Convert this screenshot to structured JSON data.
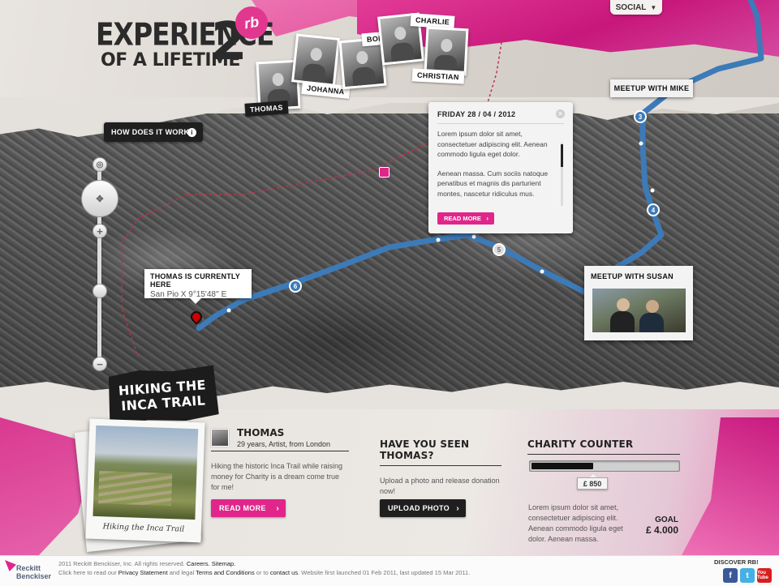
{
  "header": {
    "logo": {
      "line1": "EXPERIENCE",
      "line2": "OF A LIFETIME",
      "number": "2",
      "badge": "rb"
    },
    "social_label": "SOCIAL",
    "hikers": [
      {
        "name": "THOMAS"
      },
      {
        "name": "JOHANNA"
      },
      {
        "name": "BOB"
      },
      {
        "name": "CHARLIE"
      },
      {
        "name": "CHRISTIAN"
      }
    ]
  },
  "map": {
    "how_label": "HOW DOES IT WORK?",
    "current_location": {
      "title": "THOMAS IS CURRENTLY HERE",
      "coords": "San Pio X 9°15'48'' E"
    },
    "route_stops": [
      "3",
      "4",
      "5",
      "6"
    ],
    "blog_popup": {
      "date": "FRIDAY 28 / 04 / 2012",
      "para1": "Lorem ipsum dolor sit amet, consectetuer adipiscing elit. Aenean commodo ligula eget dolor.",
      "para2": "Aenean massa. Cum sociis natoque penatibus et magnis dis parturient montes, nascetur ridiculus mus.",
      "read_more": "READ MORE"
    },
    "meetup_mike": "MEETUP WITH MIKE",
    "meetup_susan": "MEETUP WITH SUSAN"
  },
  "plate": {
    "title": "HIKING THE INCA TRAIL"
  },
  "bottom": {
    "polaroid_caption": "Hiking the Inca Trail",
    "thomas": {
      "name": "THOMAS",
      "subtitle": "29 years, Artist, from London",
      "text": "Hiking the historic Inca Trail while raising money for Charity is a dream come true for me!",
      "button": "READ MORE"
    },
    "seen": {
      "title": "HAVE YOU SEEN THOMAS?",
      "text": "Upload a photo and release donation now!",
      "button": "UPLOAD PHOTO"
    },
    "charity": {
      "title": "CHARITY COUNTER",
      "amount": "£ 850",
      "progress": 0.42,
      "text": "Lorem ipsum dolor sit amet, consectetuer adipiscing elit. Aenean commodo ligula eget dolor. Aenean massa.",
      "goal_label": "GOAL",
      "goal_value": "£ 4.000"
    }
  },
  "footer": {
    "logo_line1": "Reckitt",
    "logo_line2": "Benckiser",
    "line1_plain": "2011 Reckitt Benckiser, Inc. All rights reserved.",
    "careers": "Careers.",
    "sitemap": "Sitemap.",
    "line2_a": "Click here to read our",
    "privacy": "Privacy Statement",
    "line2_b": "and legal",
    "terms": "Terms and Conditions",
    "line2_c": "or to",
    "contact": "contact us",
    "line2_d": ". Website first launched 01 Feb 2011, last updated 15 Mar 2011.",
    "discover": "DISCOVER RB!",
    "social": [
      {
        "icon": "facebook-icon",
        "glyph": "f"
      },
      {
        "icon": "twitter-icon",
        "glyph": "t"
      },
      {
        "icon": "youtube-icon",
        "glyph": "You Tube"
      }
    ]
  },
  "colors": {
    "accent": "#e0268b",
    "route": "#3d7ab8",
    "dark": "#1f1f1f"
  }
}
